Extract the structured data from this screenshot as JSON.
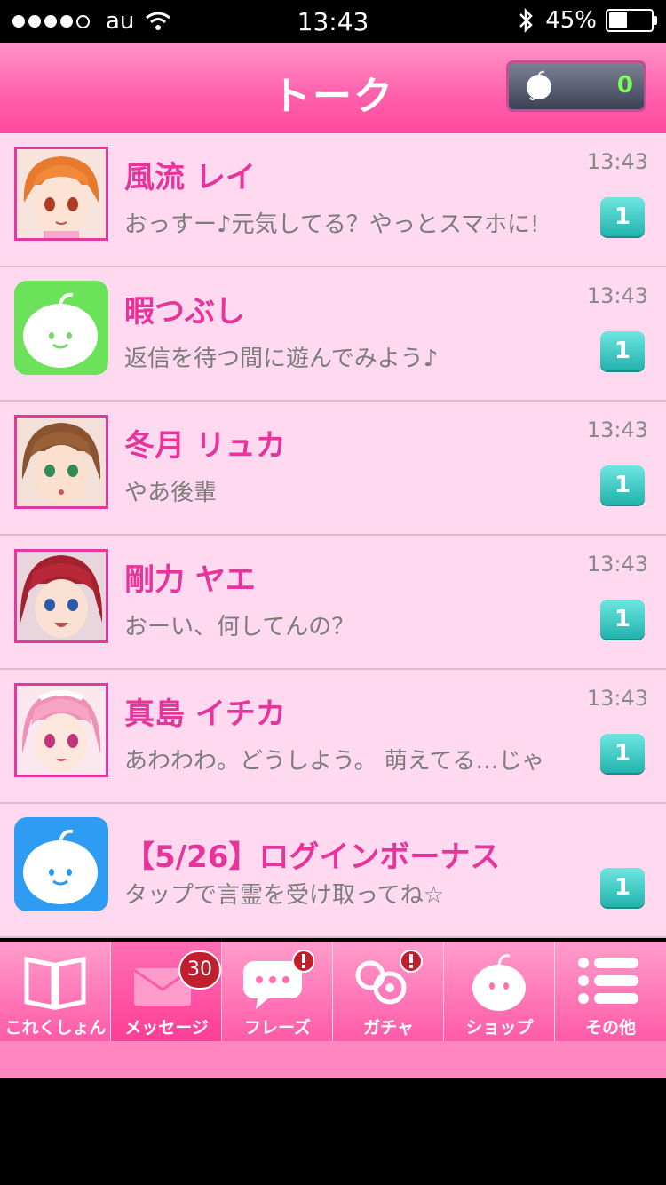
{
  "status_bar": {
    "carrier": "au",
    "time": "13:43",
    "battery": "45%",
    "battery_level": 0.45
  },
  "header": {
    "title": "トーク",
    "coin_count": "0"
  },
  "conversations": [
    {
      "name": "風流 レイ",
      "message": "おっすー♪元気してる？やっとスマホに!",
      "time": "13:43",
      "unread": "1",
      "avatar": "character-portrait-orange-hair"
    },
    {
      "name": "暇つぶし",
      "message": "返信を待つ間に遊んでみよう♪",
      "time": "13:43",
      "unread": "1",
      "avatar": "app-icon-green"
    },
    {
      "name": "冬月 リュカ",
      "message": "やあ後輩",
      "time": "13:43",
      "unread": "1",
      "avatar": "character-portrait-brown-hair"
    },
    {
      "name": "剛力 ヤエ",
      "message": "おーい、何してんの？",
      "time": "13:43",
      "unread": "1",
      "avatar": "character-portrait-red-hair"
    },
    {
      "name": "真島 イチカ",
      "message": "あわわわ。どうしよう。 萌えてる…じゃ",
      "time": "13:43",
      "unread": "1",
      "avatar": "character-portrait-pink-hair"
    },
    {
      "name": "【5/26】ログインボーナス",
      "message": "タップで言霊を受け取ってね☆",
      "time": "",
      "unread": "1",
      "avatar": "app-icon-blue"
    }
  ],
  "tabs": [
    {
      "label": "これくしょん",
      "icon": "book-icon"
    },
    {
      "label": "メッセージ",
      "icon": "envelope-icon",
      "badge": "30"
    },
    {
      "label": "フレーズ",
      "icon": "speech-bubble-icon"
    },
    {
      "label": "ガチャ",
      "icon": "gacha-icon"
    },
    {
      "label": "ショップ",
      "icon": "mascot-icon"
    },
    {
      "label": "その他",
      "icon": "menu-list-icon"
    }
  ],
  "colors": {
    "accent": "#ff4aa0",
    "name_text": "#e8339a",
    "list_bg": "#ffd9f0",
    "badge": "#22b3ad"
  }
}
